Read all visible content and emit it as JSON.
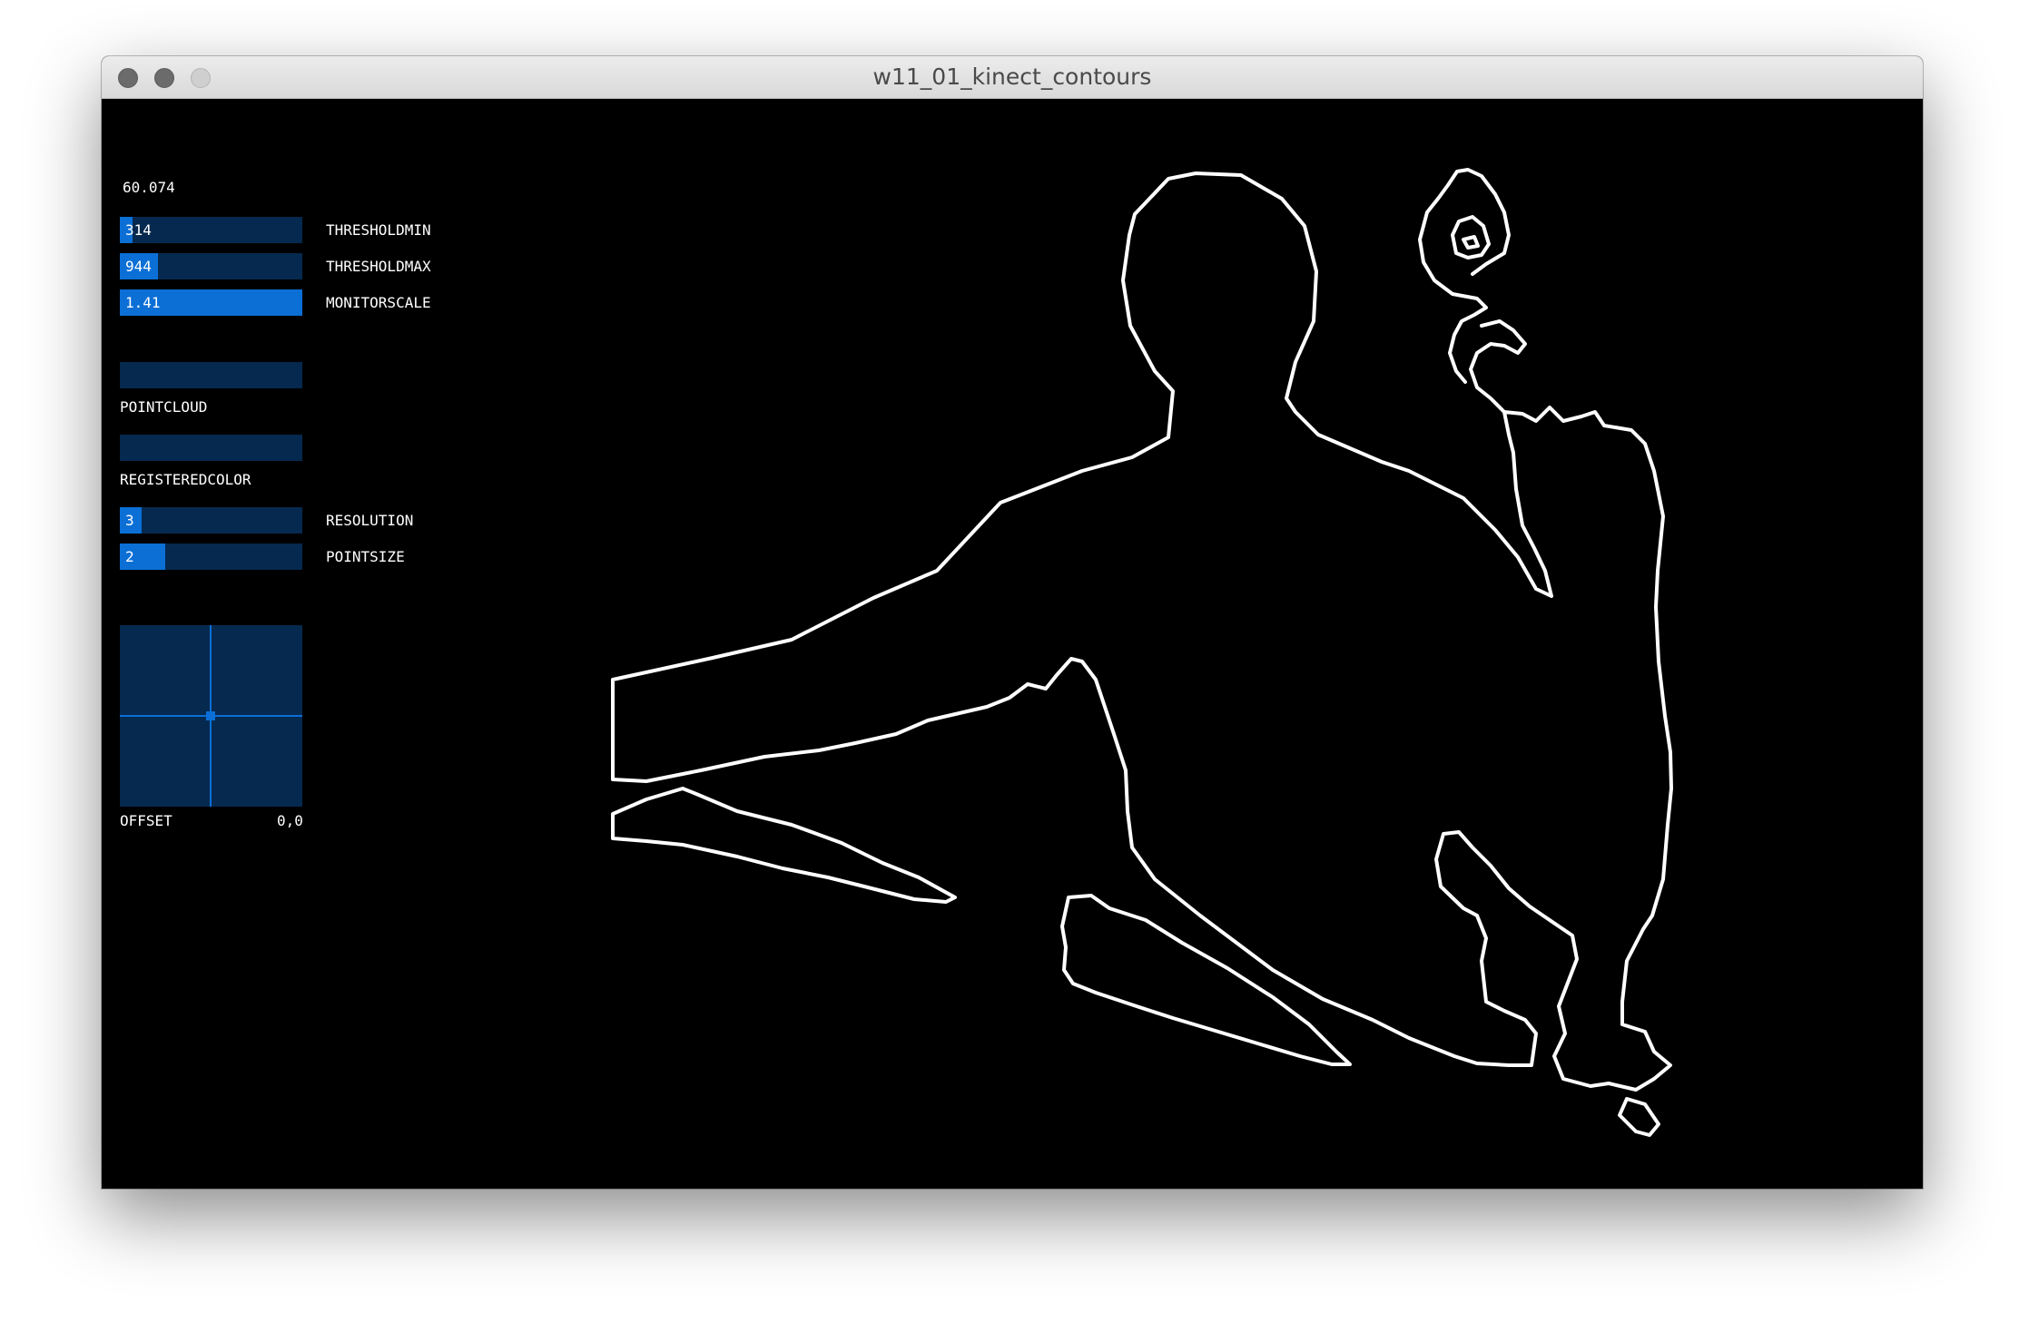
{
  "window": {
    "title": "w11_01_kinect_contours"
  },
  "panel": {
    "fps": "60.074",
    "sliders": [
      {
        "label": "THRESHOLDMIN",
        "value": "314",
        "fill_fraction": 0.07
      },
      {
        "label": "THRESHOLDMAX",
        "value": "944",
        "fill_fraction": 0.21
      },
      {
        "label": "MONITORSCALE",
        "value": "1.41",
        "fill_fraction": 1.0
      },
      {
        "label": "RESOLUTION",
        "value": "3",
        "fill_fraction": 0.12
      },
      {
        "label": "POINTSIZE",
        "value": "2",
        "fill_fraction": 0.25
      }
    ],
    "toggles": [
      {
        "label": "POINTCLOUD",
        "state": false
      },
      {
        "label": "REGISTEREDCOLOR",
        "state": false
      }
    ],
    "offset": {
      "label": "OFFSET",
      "value": "0,0"
    }
  },
  "colors": {
    "slider_bg": "#06294f",
    "slider_fill": "#0b6fd6",
    "canvas_bg": "#000000",
    "contour": "#ffffff"
  }
}
